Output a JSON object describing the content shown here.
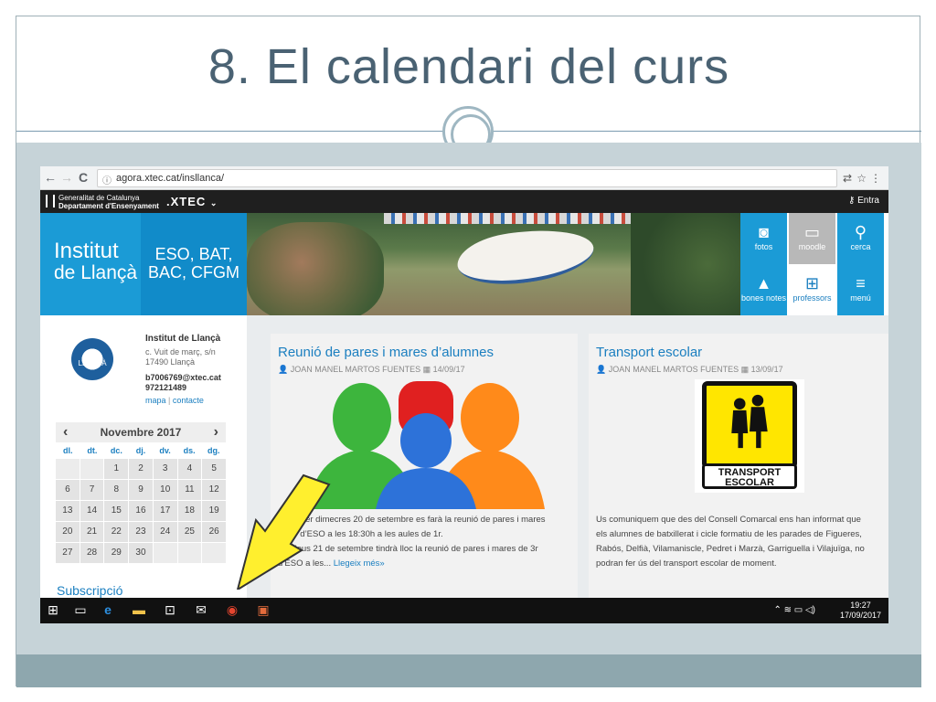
{
  "slide": {
    "title": "8. El calendari del curs"
  },
  "browser": {
    "url": "agora.xtec.cat/insllanca/",
    "back": "←",
    "forward": "→",
    "reload": "C"
  },
  "xtec_bar": {
    "gencat_line1": "Generalitat de Catalunya",
    "gencat_line2": "Departament d'Ensenyament",
    "brand": ".XTEC",
    "login": "Entra"
  },
  "banner": {
    "institute_line1": "Institut",
    "institute_line2": "de Llançà",
    "studies": "ESO, BAT, BAC, CFGM",
    "tiles": [
      {
        "label": "fotos",
        "icon": "camera-icon",
        "color": "#1b9bd6"
      },
      {
        "label": "moodle",
        "icon": "folder-icon",
        "color": "#b8b8b8"
      },
      {
        "label": "cerca",
        "icon": "search-icon",
        "color": "#1b9bd6"
      },
      {
        "label": "bones notes",
        "icon": "graduation-cap-icon",
        "color": "#1b9bd6"
      },
      {
        "label": "professors",
        "icon": "org-chart-icon",
        "color": "#ffffff"
      },
      {
        "label": "menú",
        "icon": "menu-icon",
        "color": "#1b9bd6"
      }
    ]
  },
  "school": {
    "logo_text": "INS LLANÇÀ",
    "name": "Institut de Llançà",
    "address1": "c. Vuit de març, s/n",
    "address2": "17490 Llançà",
    "email": "b7006769@xtec.cat",
    "phone": "972121489",
    "link_map": "mapa",
    "link_separator": "|",
    "link_contact": "contacte"
  },
  "calendar": {
    "month": "Novembre 2017",
    "prev": "‹",
    "next": "›",
    "weekdays": [
      "dl.",
      "dt.",
      "dc.",
      "dj.",
      "dv.",
      "ds.",
      "dg."
    ],
    "days": [
      "",
      "",
      "1",
      "2",
      "3",
      "4",
      "5",
      "6",
      "7",
      "8",
      "9",
      "10",
      "11",
      "12",
      "13",
      "14",
      "15",
      "16",
      "17",
      "18",
      "19",
      "20",
      "21",
      "22",
      "23",
      "24",
      "25",
      "26",
      "27",
      "28",
      "29",
      "30",
      "",
      "",
      ""
    ]
  },
  "subscription": "Subscripció",
  "posts": [
    {
      "title": "Reunió de pares i mares d’alumnes",
      "author": "JOAN MANEL MARTOS FUENTES",
      "date": "14/09/17",
      "body1": "El proper dimecres 20 de setembre es farà la reunió de pares i mares de 1r d’ESO a les 18:30h a les aules de 1r.",
      "body2": "El dijous 21 de setembre tindrà lloc la reunió de pares i mares de 3r d’ESO a les...",
      "read_more": "Llegeix més»"
    },
    {
      "title": "Transport escolar",
      "author": "JOAN MANEL MARTOS FUENTES",
      "date": "13/09/17",
      "sign_text": "TRANSPORT ESCOLAR",
      "body": "Us comuniquem que des del Consell Comarcal ens han informat que els alumnes de batxillerat i cicle formatiu de les parades de Figueres, Rabós, Delfià, Vilamaniscle, Pedret i Marzà, Garriguella  i Vilajuïga, no podran fer ús del transport escolar de moment."
    }
  ],
  "taskbar": {
    "time": "19:27",
    "date": "17/09/2017",
    "notifications": "2"
  }
}
